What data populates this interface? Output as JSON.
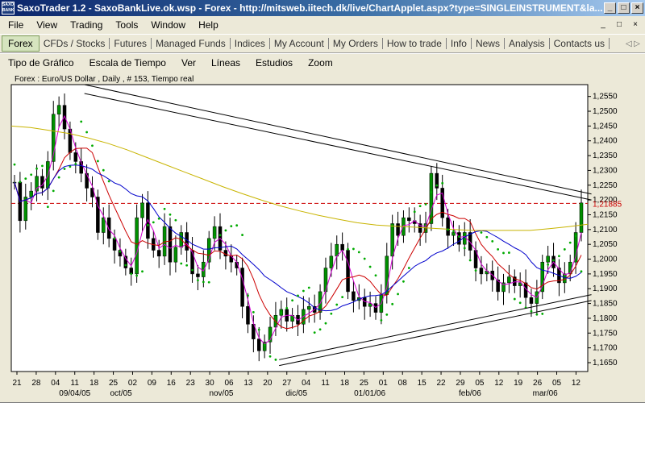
{
  "window": {
    "icon_text": "SAXO BANK",
    "title": "SaxoTrader 1.2 - SaxoBankLive.ok.wsp - Forex - http://mitsweb.iitech.dk/live/ChartApplet.aspx?type=SINGLEINSTRUMENT&la...",
    "min": "_",
    "max": "□",
    "close": "×"
  },
  "menu": [
    "File",
    "View",
    "Trading",
    "Tools",
    "Window",
    "Help"
  ],
  "mdi": {
    "min": "_",
    "restore": "□",
    "close": "×"
  },
  "nav_tabs": [
    "Forex",
    "CFDs / Stocks",
    "Futures",
    "Managed Funds",
    "Indices",
    "My Account",
    "My Orders",
    "How to trade",
    "Info",
    "News",
    "Analysis",
    "Contacts us"
  ],
  "nav_arrows": "◁ ▷",
  "chart_toolbar": [
    "Tipo de Gráfico",
    "Escala de Tiempo",
    "Ver",
    "Líneas",
    "Estudios",
    "Zoom"
  ],
  "chart_header": "Forex : Euro/US Dollar , Daily , # 153, Tiempo real",
  "colors": {
    "ma_short": "#d400d4",
    "ma_mid": "#cc0000",
    "ma_long": "#0000cc",
    "ma_slow": "#c8b400",
    "sar": "#00aa00",
    "candle": "#009000"
  },
  "chart_data": {
    "type": "candlestick",
    "instrument": "Euro/US Dollar",
    "ylim": [
      1.162,
      1.259
    ],
    "yticks": [
      "1,2550",
      "1,2500",
      "1,2450",
      "1,2400",
      "1,2350",
      "1,2300",
      "1,2250",
      "1,2200",
      "1,2150",
      "1,2100",
      "1,2050",
      "1,2000",
      "1,1950",
      "1,1900",
      "1,1850",
      "1,1800",
      "1,1750",
      "1,1700",
      "1,1650"
    ],
    "ytick_values": [
      1.255,
      1.25,
      1.245,
      1.24,
      1.235,
      1.23,
      1.225,
      1.22,
      1.215,
      1.21,
      1.205,
      1.2,
      1.195,
      1.19,
      1.185,
      1.18,
      1.175,
      1.17,
      1.165
    ],
    "current_price_label": "1,21885",
    "current_price": 1.21885,
    "day_labels": [
      "21",
      "28",
      "04",
      "11",
      "18",
      "25",
      "02",
      "09",
      "16",
      "23",
      "30",
      "06",
      "13",
      "20",
      "27",
      "04",
      "11",
      "18",
      "25",
      "01",
      "08",
      "15",
      "22",
      "29",
      "05",
      "12",
      "19",
      "26",
      "05",
      "12"
    ],
    "month_labels": [
      "09/04/05",
      "oct/05",
      "nov/05",
      "dic/05",
      "01/01/06",
      "feb/06",
      "mar/06"
    ],
    "month_label_positions": [
      3,
      5.4,
      10.6,
      14.5,
      18.3,
      23.5,
      27.4
    ],
    "closes": [
      1.226,
      1.213,
      1.221,
      1.223,
      1.228,
      1.224,
      1.233,
      1.249,
      1.252,
      1.244,
      1.236,
      1.233,
      1.229,
      1.224,
      1.221,
      1.209,
      1.214,
      1.207,
      1.203,
      1.201,
      1.197,
      1.195,
      1.214,
      1.219,
      1.207,
      1.203,
      1.201,
      1.211,
      1.199,
      1.204,
      1.209,
      1.203,
      1.195,
      1.194,
      1.199,
      1.207,
      1.211,
      1.203,
      1.201,
      1.199,
      1.197,
      1.184,
      1.178,
      1.173,
      1.169,
      1.172,
      1.177,
      1.181,
      1.183,
      1.179,
      1.181,
      1.178,
      1.183,
      1.184,
      1.182,
      1.189,
      1.197,
      1.201,
      1.205,
      1.203,
      1.189,
      1.186,
      1.187,
      1.184,
      1.185,
      1.182,
      1.188,
      1.201,
      1.212,
      1.208,
      1.214,
      1.213,
      1.212,
      1.209,
      1.212,
      1.229,
      1.224,
      1.214,
      1.208,
      1.209,
      1.205,
      1.209,
      1.203,
      1.197,
      1.195,
      1.196,
      1.193,
      1.189,
      1.192,
      1.194,
      1.191,
      1.192,
      1.187,
      1.185,
      1.189,
      1.199,
      1.201,
      1.197,
      1.192,
      1.195,
      1.199,
      1.209,
      1.219
    ],
    "ma_slow": [
      1.245,
      1.2445,
      1.2435,
      1.2425,
      1.241,
      1.2392,
      1.237,
      1.2345,
      1.232,
      1.2295,
      1.227,
      1.2245,
      1.2222,
      1.22,
      1.218,
      1.2163,
      1.2148,
      1.2135,
      1.2123,
      1.2115,
      1.2111,
      1.2108,
      1.2104,
      1.21,
      1.2097,
      1.2097,
      1.2097,
      1.2097,
      1.2103,
      1.211,
      1.2118
    ],
    "upper_channel": {
      "x0": 3.5,
      "y0": 1.259,
      "x1": 29.8,
      "y1": 1.222
    },
    "upper_channel_2": {
      "x0": 3.5,
      "y0": 1.256,
      "x1": 29.8,
      "y1": 1.22
    },
    "lower_channel": {
      "x0": 13.6,
      "y0": 1.166,
      "x1": 29.8,
      "y1": 1.188
    },
    "lower_channel_2": {
      "x0": 13.6,
      "y0": 1.164,
      "x1": 29.8,
      "y1": 1.186
    }
  }
}
